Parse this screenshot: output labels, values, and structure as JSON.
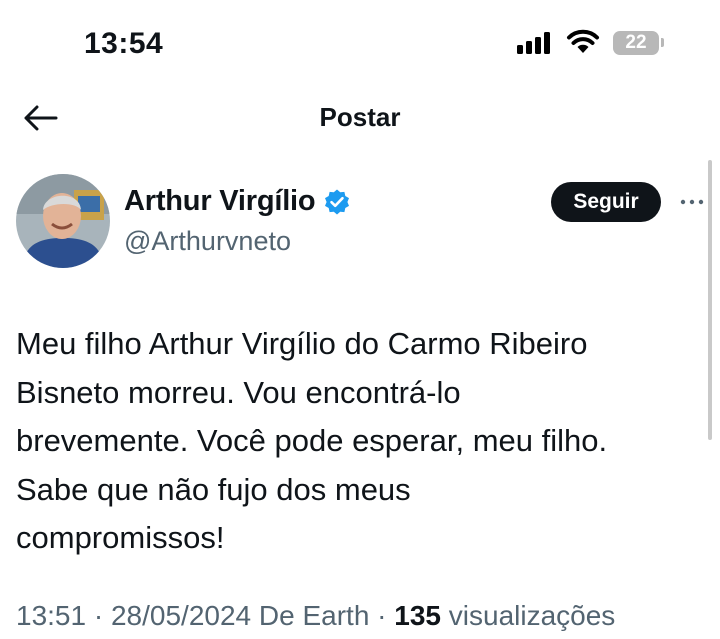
{
  "status_bar": {
    "time": "13:54",
    "battery": "22"
  },
  "header": {
    "title": "Postar"
  },
  "author": {
    "name": "Arthur Virgílio",
    "handle": "@Arthurvneto",
    "verified": true
  },
  "actions": {
    "follow_label": "Seguir"
  },
  "post": {
    "text": "Meu filho Arthur Virgílio do Carmo Ribeiro\nBisneto morreu. Vou encontrá-lo\nbrevemente. Você pode esperar, meu filho.\nSabe que não fujo dos meus\ncompromissos!",
    "time": "13:51",
    "date": "28/05/2024",
    "source": "De Earth",
    "views_count": "135",
    "views_label": "visualizações",
    "separator": "·"
  },
  "colors": {
    "text": "#0f1419",
    "secondary": "#536471",
    "verified": "#1d9bf0",
    "follow_bg": "#0f1419"
  }
}
